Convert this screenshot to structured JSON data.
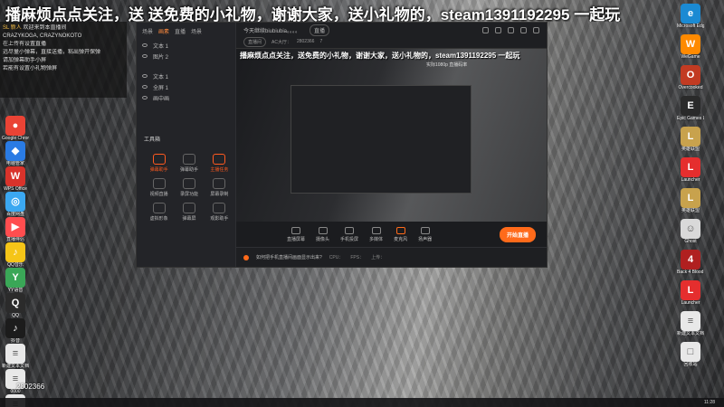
{
  "overlay": {
    "marquee": "播麻烦点点关注，送 送免费的小礼物，谢谢大家，送小礼物的，steam1391192295 一起玩",
    "chat_lines": [
      {
        "name": "SL 新人",
        "text": "欢迎来到本直播间"
      },
      {
        "name": "",
        "text": "CRAZYKOGA, CRAZYNOKOTO"
      },
      {
        "name": "",
        "text": "在上传有设置直播"
      },
      {
        "name": "",
        "text": "远尽量小弹幕，直接送播，粘出弹开保弹"
      },
      {
        "name": "",
        "text": "请加弹幕助手小屏"
      },
      {
        "name": "",
        "text": "若能有设置小礼物弹屏"
      }
    ],
    "room_id": "2802366"
  },
  "desktop_icons_left": [
    {
      "label": "Google Chrome",
      "color": "#ea4335",
      "glyph": "●"
    },
    {
      "label": "电脑管家",
      "color": "#2a7be4",
      "glyph": "◆"
    },
    {
      "label": "WPS Office",
      "color": "#d9332b",
      "glyph": "W"
    },
    {
      "label": "百度网盘",
      "color": "#3ba8f1",
      "glyph": "◎"
    },
    {
      "label": "直播伴侣",
      "color": "#ff4d4f",
      "glyph": "▶"
    },
    {
      "label": "QQ音乐",
      "color": "#f5c518",
      "glyph": "♪"
    },
    {
      "label": "YY语音",
      "color": "#3aa757",
      "glyph": "Y"
    },
    {
      "label": "QQ",
      "color": "#2b2b2b",
      "glyph": "Q"
    },
    {
      "label": "抖音",
      "color": "#1c1c1c",
      "glyph": "♪"
    },
    {
      "label": "新建文本文档",
      "color": "#e8e8e8",
      "glyph": "≡"
    },
    {
      "label": "0000",
      "color": "#e8e8e8",
      "glyph": "≡"
    },
    {
      "label": "新建文本文档",
      "color": "#e8e8e8",
      "glyph": "≡"
    }
  ],
  "desktop_icons_right": [
    {
      "label": "Microsoft Edge",
      "color": "#1b8ad3",
      "glyph": "e"
    },
    {
      "label": "WeGame",
      "color": "#ff8a00",
      "glyph": "W"
    },
    {
      "label": "Overcooked",
      "color": "#c23b22",
      "glyph": "O"
    },
    {
      "label": "Epic Games Launcher",
      "color": "#2a2a2a",
      "glyph": "E"
    },
    {
      "label": "英雄联盟",
      "color": "#c8a24d",
      "glyph": "L"
    },
    {
      "label": "Launcher",
      "color": "#e52e2e",
      "glyph": "L"
    },
    {
      "label": "英雄联盟",
      "color": "#c8a24d",
      "glyph": "L"
    },
    {
      "label": "Ghost",
      "color": "#d9d9d9",
      "glyph": "☺"
    },
    {
      "label": "Back 4 Blood Beta",
      "color": "#b02020",
      "glyph": "4"
    },
    {
      "label": "Launcher",
      "color": "#e52e2e",
      "glyph": "L"
    },
    {
      "label": "新建文本文档",
      "color": "#e8e8e8",
      "glyph": "≡"
    },
    {
      "label": "回收站",
      "color": "#e8e8e8",
      "glyph": "□"
    }
  ],
  "app": {
    "tabs": [
      "场景",
      "画素",
      "直播",
      "场景"
    ],
    "active_tab_index": 1,
    "scenes": [
      {
        "name": "文本 1"
      },
      {
        "name": "图片 2"
      },
      {
        "name": "文本 1"
      },
      {
        "name": "全屏 1"
      },
      {
        "name": "画中画"
      }
    ],
    "toolbox_title": "工具箱",
    "tools": [
      {
        "label": "弹幕助手",
        "hot": true
      },
      {
        "label": "弹幕助手",
        "hot": false
      },
      {
        "label": "主播任务",
        "hot": true
      },
      {
        "label": "视频直播",
        "hot": false
      },
      {
        "label": "录屏功能",
        "hot": false
      },
      {
        "label": "屏幕录制",
        "hot": false
      },
      {
        "label": "虚拟形象",
        "hot": false
      },
      {
        "label": "弹幕屏",
        "hot": false
      },
      {
        "label": "观影助手",
        "hot": false
      }
    ],
    "header_title": "今天继续biubiubia。。。。",
    "header_badge": "直播",
    "sub_header": {
      "pill": "直播间",
      "acfun": "AC大厅：",
      "fans": "2802366",
      "likes": "7"
    },
    "preview_marquee": "播麻烦点点关注，送免费的小礼物，谢谢大家，送小礼物的，steam1391192295 一起玩",
    "bitrate": "实际1080p 直播码率",
    "bottom_items": [
      "直播屏幕",
      "摄像头",
      "手机投屏",
      "多媒体",
      "麦克风",
      "扬声器"
    ],
    "live_button": "开始直播",
    "status_hint": "如何把手机直播间画面显示出来?",
    "status_items": [
      "CPU：",
      "FPS：",
      "上传："
    ]
  },
  "taskbar": {
    "time": "11:28"
  }
}
